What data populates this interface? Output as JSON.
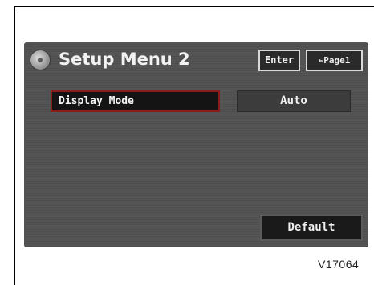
{
  "header": {
    "title": "Setup Menu 2",
    "icon": "disc-icon"
  },
  "toolbar": {
    "enter_label": "Enter",
    "page1_label": "←Page1"
  },
  "settings": {
    "display_mode_label": "Display Mode",
    "display_mode_value": "Auto"
  },
  "footer": {
    "default_label": "Default"
  },
  "caption": "V17064",
  "colors": {
    "screen_bg": "#545454",
    "highlight_border": "#8a1c1c",
    "button_border": "#d9d9d9"
  }
}
